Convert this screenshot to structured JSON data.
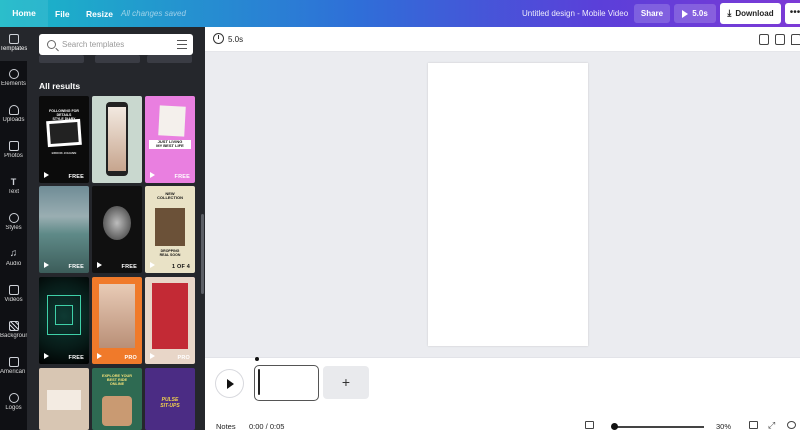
{
  "topbar": {
    "home": "Home",
    "file": "File",
    "resize": "Resize",
    "saved_status": "All changes saved",
    "design_name": "Untitled design - Mobile Video",
    "share": "Share",
    "play_duration": "5.0s",
    "download": "Download",
    "more": "•••"
  },
  "rail": {
    "items": [
      {
        "label": "Templates",
        "icon": "templates-icon"
      },
      {
        "label": "Elements",
        "icon": "elements-icon"
      },
      {
        "label": "Uploads",
        "icon": "upload-icon"
      },
      {
        "label": "Photos",
        "icon": "photos-icon"
      },
      {
        "label": "Text",
        "icon": "text-icon"
      },
      {
        "label": "Styles",
        "icon": "styles-icon"
      },
      {
        "label": "Audio",
        "icon": "audio-icon"
      },
      {
        "label": "Videos",
        "icon": "videos-icon"
      },
      {
        "label": "Background",
        "icon": "background-icon"
      },
      {
        "label": "American ...",
        "icon": "folder-icon"
      },
      {
        "label": "Logos",
        "icon": "logo-icon"
      }
    ]
  },
  "panel": {
    "search_placeholder": "Search templates",
    "section_title": "All results",
    "thumbs": [
      {
        "badge": "FREE",
        "text": "FOLLOWING FOR DETAILS\nSTYLE DIARY",
        "caption": "BROOK JOHANN"
      },
      {
        "badge": "",
        "text": "",
        "caption": ""
      },
      {
        "badge": "FREE",
        "text": "JUST LIVING\nMY BEST LIFE",
        "caption": ""
      },
      {
        "badge": "FREE",
        "text": "",
        "caption": ""
      },
      {
        "badge": "FREE",
        "text": "",
        "caption": ""
      },
      {
        "badge": "1 OF 4",
        "text": "NEW\nCOLLECTION",
        "caption": "DROPPING\nREAL SOON"
      },
      {
        "badge": "FREE",
        "text": "",
        "caption": ""
      },
      {
        "badge": "PRO",
        "text": "",
        "caption": ""
      },
      {
        "badge": "PRO",
        "text": "",
        "caption": ""
      },
      {
        "badge": "",
        "text": "",
        "caption": ""
      },
      {
        "badge": "",
        "text": "EXPLORE YOUR\nBEST RIDE\nONLINE",
        "caption": ""
      },
      {
        "badge": "",
        "text": "PULSE\nSIT-UPS",
        "caption": ""
      }
    ]
  },
  "toolbar": {
    "duration": "5.0s"
  },
  "timeline": {
    "add": "+",
    "notes": "Notes",
    "time": "0:00 / 0:05",
    "zoom": "30%"
  },
  "colors": {
    "gradient_start": "#19b9c7",
    "gradient_end": "#7c3ad6",
    "panel_bg": "#25272c",
    "rail_bg": "#0f1014",
    "workspace_bg": "#ebecf0"
  }
}
